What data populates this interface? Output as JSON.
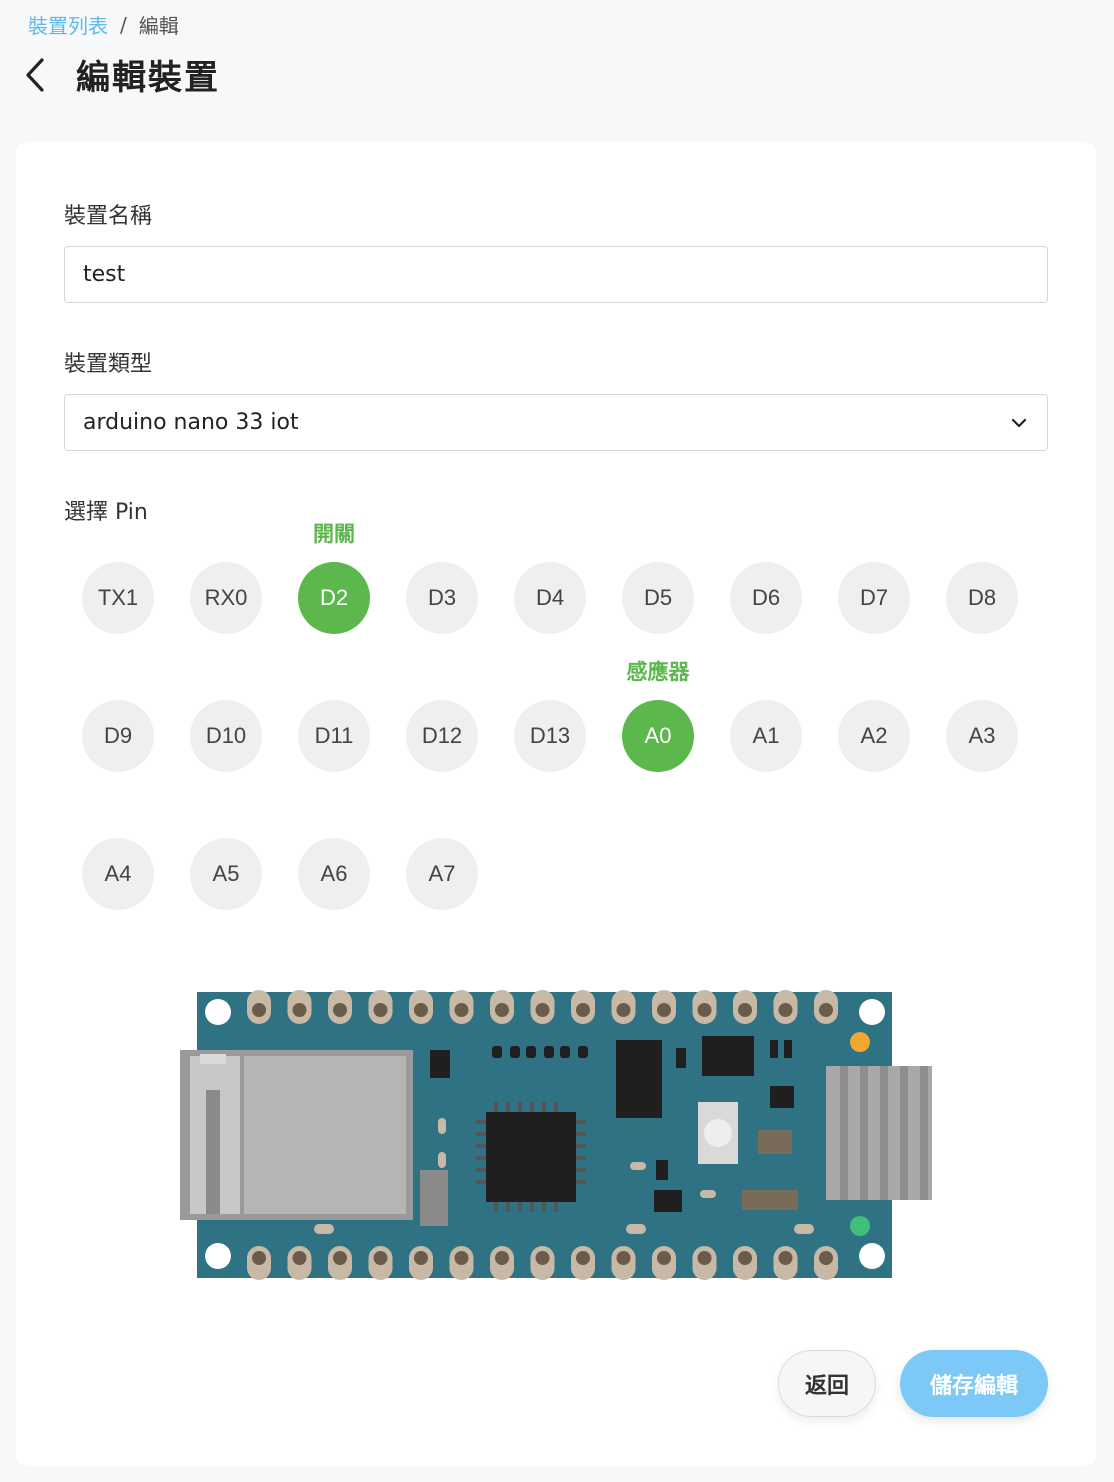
{
  "breadcrumb": {
    "parent": "裝置列表",
    "separator": "/",
    "current": "編輯"
  },
  "page": {
    "title": "編輯裝置"
  },
  "form": {
    "name_label": "裝置名稱",
    "name_value": "test",
    "type_label": "裝置類型",
    "type_value": "arduino nano 33 iot",
    "pin_label": "選擇 Pin"
  },
  "pins": [
    {
      "label": "TX1",
      "selected": false
    },
    {
      "label": "RX0",
      "selected": false
    },
    {
      "label": "D2",
      "selected": true,
      "tag": "開關"
    },
    {
      "label": "D3",
      "selected": false
    },
    {
      "label": "D4",
      "selected": false
    },
    {
      "label": "D5",
      "selected": false
    },
    {
      "label": "D6",
      "selected": false
    },
    {
      "label": "D7",
      "selected": false
    },
    {
      "label": "D8",
      "selected": false
    },
    {
      "label": "D9",
      "selected": false
    },
    {
      "label": "D10",
      "selected": false
    },
    {
      "label": "D11",
      "selected": false
    },
    {
      "label": "D12",
      "selected": false
    },
    {
      "label": "D13",
      "selected": false
    },
    {
      "label": "A0",
      "selected": true,
      "tag": "感應器"
    },
    {
      "label": "A1",
      "selected": false
    },
    {
      "label": "A2",
      "selected": false
    },
    {
      "label": "A3",
      "selected": false
    },
    {
      "label": "A4",
      "selected": false
    },
    {
      "label": "A5",
      "selected": false
    },
    {
      "label": "A6",
      "selected": false
    },
    {
      "label": "A7",
      "selected": false
    }
  ],
  "actions": {
    "back_label": "返回",
    "save_label": "儲存編輯"
  },
  "colors": {
    "accent": "#5fb8ee",
    "selected_pin": "#5cb84c",
    "board": "#2e7284",
    "save_button": "#7cc8f6"
  }
}
